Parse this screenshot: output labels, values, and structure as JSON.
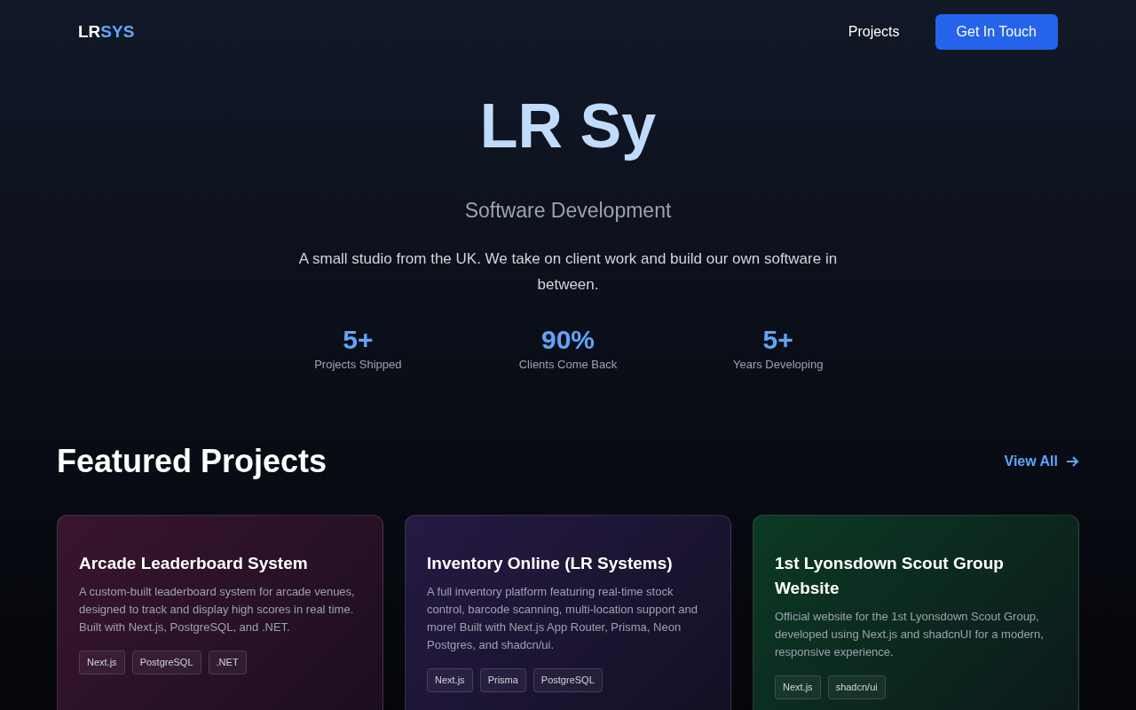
{
  "nav": {
    "logo_left": "LR",
    "logo_right": "SYS",
    "links": [
      "Projects"
    ],
    "cta": "Get In Touch"
  },
  "hero": {
    "title": "LR Sy",
    "subtitle": "Software Development",
    "description": "A small studio from the UK. We take on client work and build our own software in between.",
    "stats": [
      {
        "value": "5+",
        "label": "Projects Shipped"
      },
      {
        "value": "90%",
        "label": "Clients Come Back"
      },
      {
        "value": "5+",
        "label": "Years Developing"
      }
    ]
  },
  "featured": {
    "heading": "Featured Projects",
    "view_all": "View All",
    "projects": [
      {
        "title": "Arcade Leaderboard System",
        "color": "#3a1530",
        "description": "A custom-built leaderboard system for arcade venues, designed to track and display high scores in real time. Built with Next.js, PostgreSQL, and .NET.",
        "tags": [
          "Next.js",
          "PostgreSQL",
          ".NET"
        ]
      },
      {
        "title": "Inventory Online (LR Systems)",
        "color": "#251a44",
        "description": "A full inventory platform featuring real-time stock control, barcode scanning, multi-location support and more! Built with Next.js App Router, Prisma, Neon Postgres, and shadcn/ui.",
        "tags": [
          "Next.js",
          "Prisma",
          "PostgreSQL"
        ]
      },
      {
        "title": "1st Lyonsdown Scout Group Website",
        "color": "#0b3a24",
        "description": "Official website for the 1st Lyonsdown Scout Group, developed using Next.js and shadcnUI for a modern, responsive experience.",
        "tags": [
          "Next.js",
          "shadcn/ui"
        ]
      }
    ]
  }
}
